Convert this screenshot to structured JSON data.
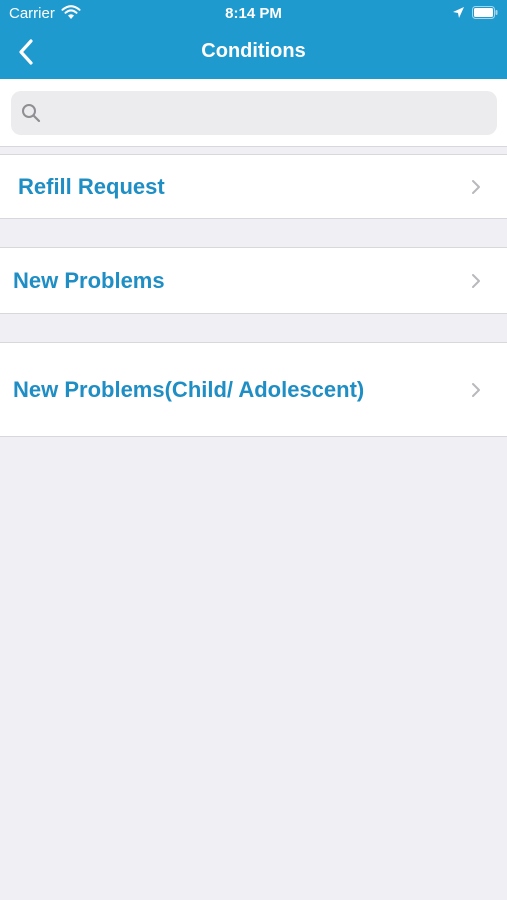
{
  "status_bar": {
    "carrier": "Carrier",
    "time": "8:14 PM",
    "icons": [
      "wifi-icon",
      "location-icon",
      "battery-icon"
    ]
  },
  "nav": {
    "title": "Conditions",
    "back_icon": "chevron-left-icon"
  },
  "search": {
    "placeholder": "",
    "value": "",
    "icon": "search-icon"
  },
  "list": {
    "items": [
      {
        "label": "Refill Request"
      },
      {
        "label": "New Problems"
      },
      {
        "label": "New Problems(Child/ Adolescent)"
      }
    ],
    "chevron_icon": "chevron-right-icon"
  },
  "colors": {
    "header_bg": "#1f9acf",
    "page_bg": "#efeff4",
    "row_text": "#1f8ec4",
    "chevron": "#b8b8bd"
  }
}
